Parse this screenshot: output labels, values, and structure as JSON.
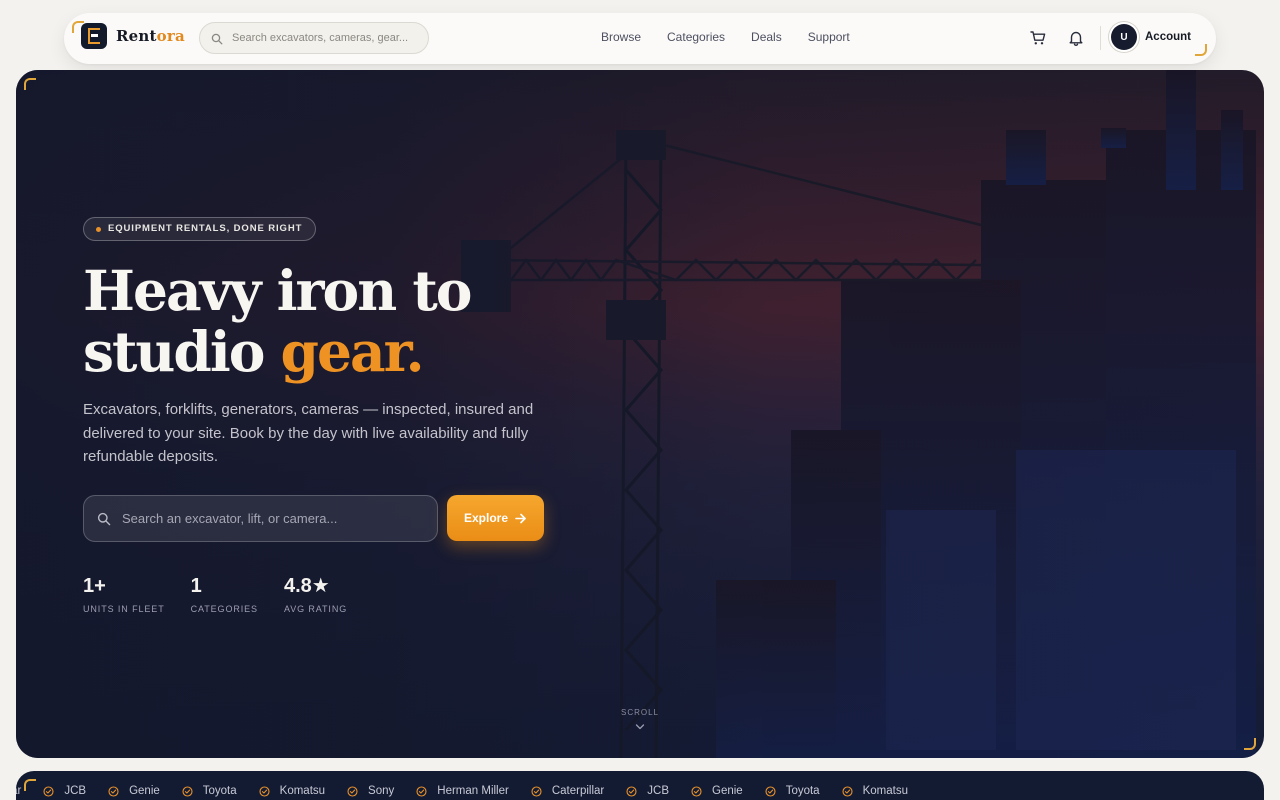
{
  "nav": {
    "brand_primary": "Rent",
    "brand_accent": "ora",
    "search_placeholder": "Search excavators, cameras, gear...",
    "links": [
      "Browse",
      "Categories",
      "Deals",
      "Support"
    ],
    "account_initial": "U",
    "account_label": "Account"
  },
  "hero": {
    "eyebrow": "EQUIPMENT RENTALS, DONE RIGHT",
    "headline_line1": "Heavy iron to",
    "headline_line2_plain": "studio ",
    "headline_line2_accent": "gear.",
    "lede": "Excavators, forklifts, generators, cameras — inspected, insured and delivered to your site. Book by the day with live availability and fully refundable deposits.",
    "search_placeholder": "Search an excavator, lift, or camera...",
    "explore_label": "Explore",
    "stats": [
      {
        "value": "1+",
        "label": "UNITS IN FLEET"
      },
      {
        "value": "1",
        "label": "CATEGORIES"
      },
      {
        "value": "4.8★",
        "label": "AVG RATING"
      }
    ],
    "scroll_label": "SCROLL"
  },
  "brand_strip": {
    "leading_fragment": "llar",
    "brands": [
      "JCB",
      "Genie",
      "Toyota",
      "Komatsu",
      "Sony",
      "Herman Miller",
      "Caterpillar",
      "JCB",
      "Genie",
      "Toyota",
      "Komatsu"
    ]
  },
  "colors": {
    "accent": "#ee9224",
    "nav_bg": "#fbfaf8",
    "hero_dark": "#181d36",
    "brand_dark": "#131a2c"
  },
  "icons": [
    "search-icon",
    "cart-icon",
    "bell-icon",
    "arrow-right-icon",
    "chevron-down-icon",
    "check-circle-icon"
  ]
}
